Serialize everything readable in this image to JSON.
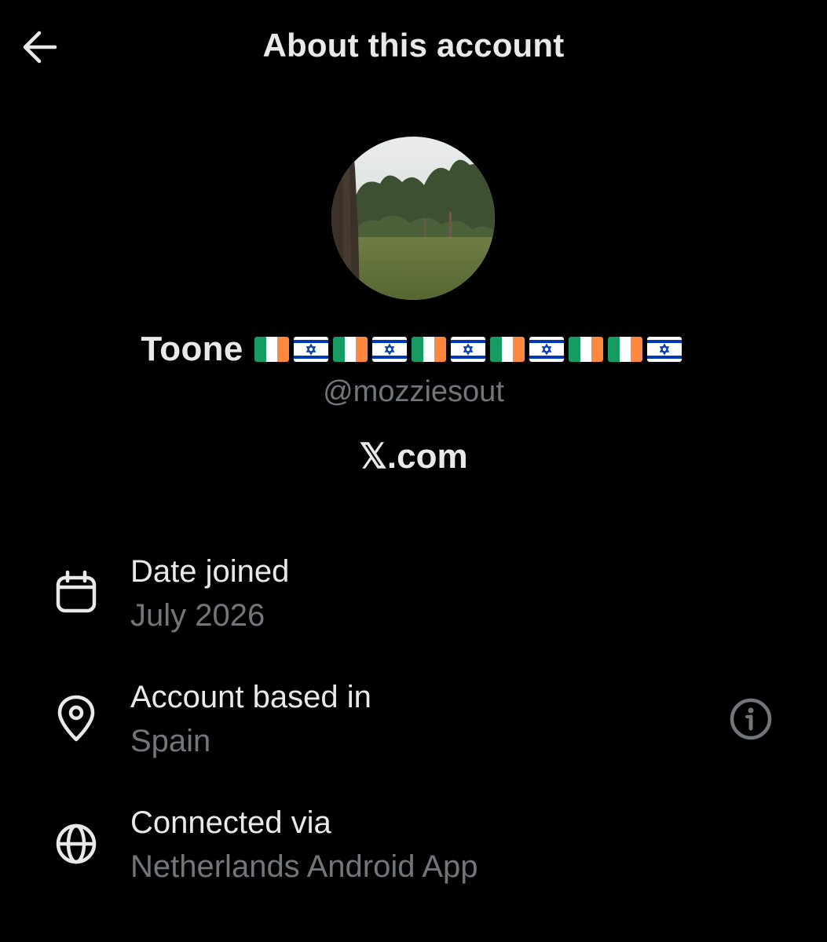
{
  "header": {
    "title": "About this account",
    "back_icon": "arrow-left-icon"
  },
  "profile": {
    "avatar_icon": "profile-photo-park",
    "display_name": "Toone",
    "name_flags": [
      "ireland",
      "israel",
      "ireland",
      "israel",
      "ireland",
      "israel",
      "ireland",
      "israel",
      "ireland",
      "ireland",
      "israel"
    ],
    "handle": "@mozziesout",
    "site": "𝕏.com"
  },
  "details": [
    {
      "icon": "calendar-icon",
      "label": "Date joined",
      "value": "July 2026"
    },
    {
      "icon": "location-pin-icon",
      "label": "Account based in",
      "value": "Spain",
      "trailing_icon": "info-icon"
    },
    {
      "icon": "globe-icon",
      "label": "Connected via",
      "value": "Netherlands Android App"
    }
  ],
  "colors": {
    "background": "#000000",
    "primary_text": "#e7e9ea",
    "secondary_text": "#71767b",
    "ireland_green": "#169b62",
    "ireland_orange": "#ff883e",
    "israel_blue": "#0038b8"
  }
}
